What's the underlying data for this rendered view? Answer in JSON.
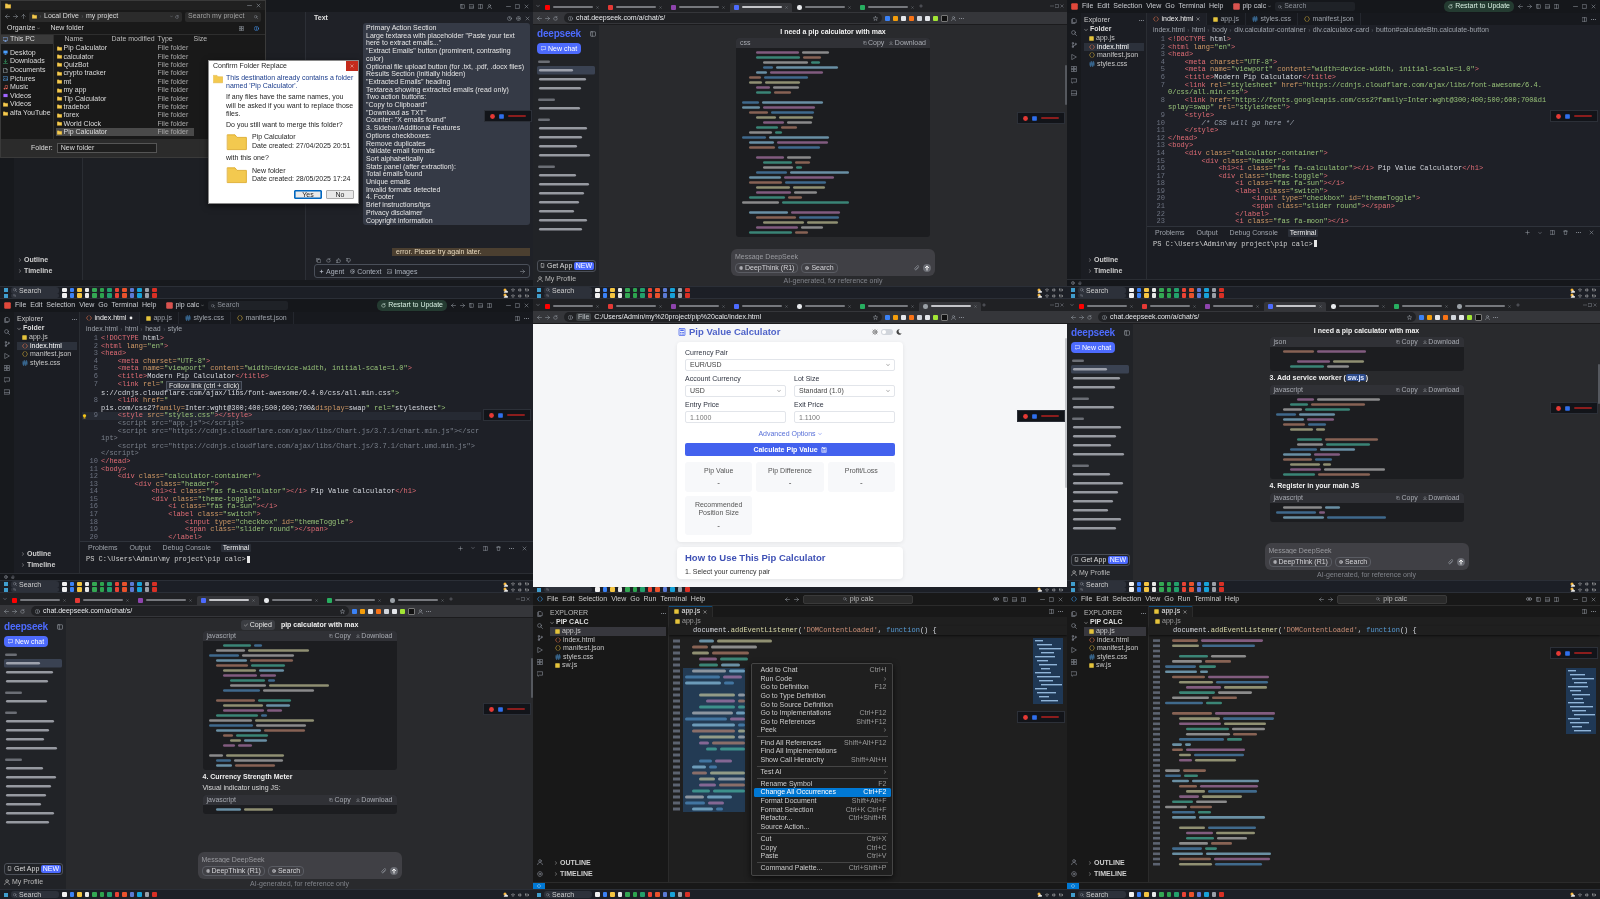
{
  "tiles": [
    {
      "kind": "explorer_chat",
      "top_taskbar": false,
      "taskbar": {
        "search": "Search"
      },
      "recorder": true,
      "explorer": {
        "path": [
          "Local Drive",
          "my project"
        ],
        "search_placeholder": "Search my project",
        "toolbar": [
          {
            "label": "Organize",
            "kind": "menu"
          },
          {
            "label": "New folder",
            "kind": "button"
          }
        ],
        "nav": [
          {
            "label": "This PC",
            "kind": "pc",
            "selected": true
          },
          {
            "label": "Desktop",
            "kind": "desktop",
            "selected": false
          },
          {
            "label": "Downloads",
            "kind": "downloads",
            "selected": false
          },
          {
            "label": "Documents",
            "kind": "documents",
            "selected": false
          },
          {
            "label": "Pictures",
            "kind": "pictures",
            "selected": false
          },
          {
            "label": "Music",
            "kind": "music",
            "selected": false
          },
          {
            "label": "Videos",
            "kind": "videos",
            "selected": false
          },
          {
            "label": "Videos",
            "kind": "folder",
            "selected": false
          },
          {
            "label": "alfa YouTube",
            "kind": "folder",
            "selected": false
          }
        ],
        "columns": [
          "Name",
          "Date modified",
          "Type",
          "Size"
        ],
        "rows": [
          {
            "name": "Pip Calculator",
            "type": "File folder",
            "selected": false
          },
          {
            "name": "calculator",
            "type": "File folder",
            "selected": false
          },
          {
            "name": "QuizBot",
            "type": "File folder",
            "selected": false
          },
          {
            "name": "crypto tracker",
            "type": "File folder",
            "selected": false
          },
          {
            "name": "mt",
            "type": "File folder",
            "selected": false
          },
          {
            "name": "my app",
            "type": "File folder",
            "selected": false
          },
          {
            "name": "Tip Calculator",
            "type": "File folder",
            "selected": false
          },
          {
            "name": "tradebot",
            "type": "File folder",
            "selected": false
          },
          {
            "name": "forex",
            "type": "File folder",
            "selected": false
          },
          {
            "name": "World Clock",
            "type": "File folder",
            "selected": false
          },
          {
            "name": "Pip Calculator",
            "type": "File folder",
            "selected": true
          }
        ],
        "folder_label": "Folder:",
        "folder_value": "New folder"
      },
      "dialog": {
        "title": "Confirm Folder Replace",
        "message": "This destination already contains a folder named 'Pip Calculator'.",
        "detail": "If any files have the same names, you will be asked if you want to replace those files.",
        "question": "Do you still want to merge this folder?",
        "existing": {
          "name": "Pip Calculator",
          "date": "Date created: 27/04/2025 20:51"
        },
        "with_label": "with this one?",
        "incoming": {
          "name": "New folder",
          "date": "Date created: 28/05/2025 17:24"
        },
        "buttons": [
          {
            "label": "Yes",
            "selected": true
          },
          {
            "label": "No",
            "selected": false
          }
        ]
      },
      "chat": {
        "title": "Text",
        "items": [
          "Primary Action Section",
          "Large textarea with placeholder \"Paste your text here to extract emails...\"",
          "\"Extract Emails\" button (prominent, contrasting color)",
          "Optional file upload button (for .txt, .pdf, .docx files)",
          "Results Section (initially hidden)",
          "\"Extracted Emails\" heading",
          "Textarea showing extracted emails (read only)",
          "Two action buttons:",
          "\"Copy to Clipboard\"",
          "\"Download as TXT\"",
          "Counter: \"X emails found\"",
          "3. Sidebar/Additional Features",
          "Options checkboxes:",
          "Remove duplicates",
          "Validate email formats",
          "Sort alphabetically",
          "Stats panel (after extraction):",
          "Total emails found",
          "Unique emails",
          "Invalid formats detected",
          "4. Footer",
          "Brief instructions/tips",
          "Privacy disclaimer",
          "Copyright information"
        ],
        "error": "error. Please try again later.",
        "chips": [
          {
            "label": "Agent",
            "kind": "agent"
          },
          {
            "label": "Context",
            "kind": "context"
          },
          {
            "label": "Images",
            "kind": "images"
          }
        ]
      },
      "panels": [
        "Outline",
        "Timeline"
      ]
    },
    {
      "kind": "deepseek",
      "top_taskbar": false,
      "taskbar": {
        "search": "Search"
      },
      "recorder": true,
      "browser": {
        "tabs": [
          {
            "selected": false
          },
          {
            "selected": false
          },
          {
            "selected": false
          },
          {
            "selected": true
          },
          {
            "selected": false
          },
          {
            "selected": false
          }
        ],
        "url": "chat.deepseek.com/a/chat/s/"
      },
      "sidebar": {
        "logo": "deepseek",
        "new_chat": "New chat",
        "sections": [
          {
            "items": [
              {
                "selected": true
              },
              {
                "selected": false
              },
              {
                "selected": false
              }
            ]
          },
          {
            "items": [
              {
                "selected": false
              }
            ]
          },
          {
            "items": [
              {
                "selected": false
              },
              {
                "selected": false
              },
              {
                "selected": false
              },
              {
                "selected": false
              }
            ]
          },
          {
            "items": [
              {
                "selected": false
              },
              {
                "selected": false
              },
              {
                "selected": false
              },
              {
                "selected": false
              },
              {
                "selected": false
              },
              {
                "selected": false
              },
              {
                "selected": false
              }
            ]
          }
        ],
        "get_app": "Get App",
        "badge": "NEW",
        "profile": "My Profile"
      },
      "chat": {
        "title": "I need a pip calculator with max",
        "blocks": [
          {
            "kind": "code",
            "lang": "css",
            "copy": "Copy",
            "download": "Download"
          }
        ],
        "placeholder": "Message DeepSeek",
        "chips": [
          {
            "label": "DeepThink (R1)",
            "kind": "deepthink"
          },
          {
            "label": "Search",
            "kind": "search"
          }
        ],
        "footer": "AI-generated, for reference only"
      }
    },
    {
      "kind": "editor",
      "top_taskbar": false,
      "taskbar": {
        "search": "Search"
      },
      "recorder": true,
      "menu": [
        "File",
        "Edit",
        "Selection",
        "View",
        "Go",
        "Terminal",
        "Help"
      ],
      "project": "pip calc",
      "search_placeholder": "Search",
      "update": "Restart to Update",
      "explorer": "Explorer",
      "folder": "Folder",
      "files": [
        {
          "name": "app.js",
          "kind": "js",
          "selected": false
        },
        {
          "name": "index.html",
          "kind": "html",
          "selected": true
        },
        {
          "name": "manifest.json",
          "kind": "json",
          "selected": false
        },
        {
          "name": "styles.css",
          "kind": "css",
          "selected": false
        }
      ],
      "tabs": [
        {
          "label": "index.html",
          "kind": "html",
          "selected": true,
          "modified": false
        },
        {
          "label": "app.js",
          "kind": "js",
          "selected": false,
          "modified": false
        },
        {
          "label": "styles.css",
          "kind": "css",
          "selected": false,
          "modified": false
        },
        {
          "label": "manifest.json",
          "kind": "json",
          "selected": false,
          "modified": false
        }
      ],
      "breadcrumb": [
        "index.html",
        "html",
        "body",
        "div.calculator-container",
        "div.calculator-card",
        "button#calculateBtn.calculate-button"
      ],
      "code": [
        {
          "n": "1",
          "kind": "line",
          "text": "<!DOCTYPE html>"
        },
        {
          "n": "2",
          "kind": "line",
          "text": "<html lang=\"en\">"
        },
        {
          "n": "3",
          "kind": "line",
          "text": "<head>"
        },
        {
          "n": "4",
          "kind": "line",
          "text": "    <meta charset=\"UTF-8\">"
        },
        {
          "n": "5",
          "kind": "line",
          "text": "    <meta name=\"viewport\" content=\"width=device-width, initial-scale=1.0\">"
        },
        {
          "n": "6",
          "kind": "line",
          "text": "    <title>Modern Pip Calculator</title>"
        },
        {
          "n": "7",
          "kind": "line",
          "text": "    <link rel=\"stylesheet\" href=\"https://cdnjs.cloudflare.com/ajax/libs/font-awesome/6.4.0/css/all.min.css\">"
        },
        {
          "n": "8",
          "kind": "line",
          "text": "    <link href=\"https://fonts.googleapis.com/css2?family=Inter:wght@300;400;500;600;700&display=swap\" rel=\"stylesheet\">"
        },
        {
          "n": "9",
          "kind": "line",
          "text": "    <style>"
        },
        {
          "n": "10",
          "kind": "line",
          "text": "        /* CSS will go here */"
        },
        {
          "n": "11",
          "kind": "line",
          "text": "    </style>"
        },
        {
          "n": "12",
          "kind": "line",
          "text": "</head>"
        },
        {
          "n": "13",
          "kind": "line",
          "text": "<body>"
        },
        {
          "n": "14",
          "kind": "line",
          "text": "    <div class=\"calculator-container\">"
        },
        {
          "n": "15",
          "kind": "line",
          "text": "        <div class=\"header\">"
        },
        {
          "n": "16",
          "kind": "line",
          "text": "            <h1><i class=\"fas fa-calculator\"></i> Pip Value Calculator</h1>"
        },
        {
          "n": "17",
          "kind": "line",
          "text": "            <div class=\"theme-toggle\">"
        },
        {
          "n": "18",
          "kind": "line",
          "text": "                <i class=\"fas fa-sun\"></i>"
        },
        {
          "n": "19",
          "kind": "line",
          "text": "                <label class=\"switch\">"
        },
        {
          "n": "20",
          "kind": "line",
          "text": "                    <input type=\"checkbox\" id=\"themeToggle\">"
        },
        {
          "n": "21",
          "kind": "line",
          "text": "                    <span class=\"slider round\"></span>"
        },
        {
          "n": "22",
          "kind": "line",
          "text": "                </label>"
        },
        {
          "n": "23",
          "kind": "line",
          "text": "                <i class=\"fas fa-moon\"></i>"
        }
      ],
      "panel_tabs": [
        {
          "label": "Problems",
          "selected": false
        },
        {
          "label": "Output",
          "selected": false
        },
        {
          "label": "Debug Console",
          "selected": false
        },
        {
          "label": "Terminal",
          "selected": true
        }
      ],
      "terminal": "PS C:\\Users\\Admin\\my project\\pip calc>",
      "sections": [
        "Outline",
        "Timeline"
      ]
    },
    {
      "kind": "editor",
      "top_taskbar": true,
      "taskbar": {
        "search": "Search"
      },
      "recorder": true,
      "menu": [
        "File",
        "Edit",
        "Selection",
        "View",
        "Go",
        "Terminal",
        "Help"
      ],
      "project": "pip calc",
      "search_placeholder": "Search",
      "update": "Restart to Update",
      "explorer": "Explorer",
      "folder": "Folder",
      "files": [
        {
          "name": "app.js",
          "kind": "js",
          "selected": false
        },
        {
          "name": "index.html",
          "kind": "html",
          "selected": true
        },
        {
          "name": "manifest.json",
          "kind": "json",
          "selected": false
        },
        {
          "name": "styles.css",
          "kind": "css",
          "selected": false
        }
      ],
      "tabs": [
        {
          "label": "index.html",
          "kind": "html",
          "selected": true,
          "modified": true
        },
        {
          "label": "app.js",
          "kind": "js",
          "selected": false,
          "modified": false
        },
        {
          "label": "styles.css",
          "kind": "css",
          "selected": false,
          "modified": false
        },
        {
          "label": "manifest.json",
          "kind": "json",
          "selected": false,
          "modified": false
        }
      ],
      "breadcrumb": [
        "index.html",
        "html",
        "head",
        "style"
      ],
      "code": [
        {
          "n": "1",
          "kind": "line",
          "text": "<!DOCTYPE html>"
        },
        {
          "n": "2",
          "kind": "line",
          "text": "<html lang=\"en\">"
        },
        {
          "n": "3",
          "kind": "line",
          "text": "<head>"
        },
        {
          "n": "4",
          "kind": "line",
          "text": "    <meta charset=\"UTF-8\">"
        },
        {
          "n": "5",
          "kind": "line",
          "text": "    <meta name=\"viewport\" content=\"width=device-width, initial-scale=1.0\">"
        },
        {
          "n": "6",
          "kind": "line",
          "text": "    <title>Modern Pip Calculator</title>"
        },
        {
          "n": "7",
          "kind": "line",
          "text": "    <link rel=\"",
          "tooltip": "Follow link (ctrl + click)",
          "after": "s://cdnjs.cloudflare.com/ajax/libs/font-awesome/6.4.0/css/all.min.css\">"
        },
        {
          "n": "8",
          "kind": "line",
          "text": "    <link href=\"",
          "after": "pis.com/css2?family=Inter:wght@300;400;500;600;700&display=swap\" rel=\"stylesheet\">"
        },
        {
          "n": "9",
          "kind": "current",
          "text": "    <style src=\"styles.css\"></style>"
        },
        {
          "kind": "ghost",
          "text": "    <script src=\"app.js\"></script>"
        },
        {
          "kind": "ghost",
          "text": "    <script src=\"https://cdnjs.cloudflare.com/ajax/libs/Chart.js/3.7.1/chart.min.js\"></script>"
        },
        {
          "kind": "ghost",
          "text": "    <script src=\"https://cdnjs.cloudflare.com/ajax/libs/Chart.js/3.7.1/chart.umd.min.js\"></script>"
        },
        {
          "n": "10",
          "kind": "line",
          "text": "</head>"
        },
        {
          "n": "11",
          "kind": "line",
          "text": "<body>"
        },
        {
          "n": "12",
          "kind": "line",
          "text": "    <div class=\"calculator-container\">"
        },
        {
          "n": "13",
          "kind": "line",
          "text": "        <div class=\"header\">"
        },
        {
          "n": "14",
          "kind": "line",
          "text": "            <h1><i class=\"fas fa-calculator\"></i> Pip Value Calculator</h1>"
        },
        {
          "n": "15",
          "kind": "line",
          "text": "            <div class=\"theme-toggle\">"
        },
        {
          "n": "16",
          "kind": "line",
          "text": "                <i class=\"fas fa-sun\"></i>"
        },
        {
          "n": "17",
          "kind": "line",
          "text": "                <label class=\"switch\">"
        },
        {
          "n": "18",
          "kind": "line",
          "text": "                    <input type=\"checkbox\" id=\"themeToggle\">"
        },
        {
          "n": "19",
          "kind": "line",
          "text": "                    <span class=\"slider round\"></span>"
        },
        {
          "n": "20",
          "kind": "line",
          "text": "                </label>"
        }
      ],
      "panel_tabs": [
        {
          "label": "Problems",
          "selected": false
        },
        {
          "label": "Output",
          "selected": false
        },
        {
          "label": "Debug Console",
          "selected": false
        },
        {
          "label": "Terminal",
          "selected": true
        }
      ],
      "terminal": "PS C:\\Users\\Admin\\my project\\pip calc>",
      "sections": [
        "Outline",
        "Timeline"
      ]
    },
    {
      "kind": "calculator",
      "top_taskbar": true,
      "recorder": true,
      "browser": {
        "tabs": [
          {
            "selected": false
          },
          {
            "selected": false
          },
          {
            "selected": false
          },
          {
            "selected": false
          },
          {
            "selected": false
          },
          {
            "selected": false
          },
          {
            "selected": true
          }
        ],
        "scheme": "File",
        "url": "C:/Users/Admin/my%20project/pip%20calc/index.html"
      },
      "page": {
        "title": "Pip Value Calculator",
        "dark_mode": false,
        "field_rows": [
          [
            {
              "label": "Currency Pair",
              "kind": "select",
              "value": "EUR/USD"
            }
          ],
          [
            {
              "label": "Account Currency",
              "kind": "select",
              "value": "USD"
            },
            {
              "label": "Lot Size",
              "kind": "select",
              "value": "Standard (1.0)"
            }
          ],
          [
            {
              "label": "Entry Price",
              "kind": "input",
              "placeholder": "1.1000"
            },
            {
              "label": "Exit Price",
              "kind": "input",
              "placeholder": "1.1100"
            }
          ]
        ],
        "advanced": "Advanced Options",
        "button": "Calculate Pip Value",
        "results": [
          {
            "label": "Pip Value",
            "value": "-"
          },
          {
            "label": "Pip Difference",
            "value": "-"
          },
          {
            "label": "Profit/Loss",
            "value": "-"
          },
          {
            "label": "Recommended Position Size",
            "value": "-"
          }
        ],
        "howto_title": "How to Use This Pip Calculator",
        "howto_steps": [
          "1. Select your currency pair"
        ]
      }
    },
    {
      "kind": "deepseek",
      "top_taskbar": true,
      "taskbar": {
        "search": "Search"
      },
      "recorder": true,
      "browser": {
        "tabs": [
          {
            "selected": false
          },
          {
            "selected": false
          },
          {
            "selected": false
          },
          {
            "selected": true
          },
          {
            "selected": false
          },
          {
            "selected": false
          },
          {
            "selected": false
          }
        ],
        "url": "chat.deepseek.com/a/chat/s/"
      },
      "sidebar": {
        "logo": "deepseek",
        "new_chat": "New chat",
        "sections": [
          {
            "items": [
              {
                "selected": true
              },
              {
                "selected": false
              },
              {
                "selected": false
              }
            ]
          },
          {
            "items": [
              {
                "selected": false
              }
            ]
          },
          {
            "items": [
              {
                "selected": false
              },
              {
                "selected": false
              },
              {
                "selected": false
              },
              {
                "selected": false
              }
            ]
          },
          {
            "items": [
              {
                "selected": false
              },
              {
                "selected": false
              },
              {
                "selected": false
              },
              {
                "selected": false
              },
              {
                "selected": false
              },
              {
                "selected": false
              },
              {
                "selected": false
              }
            ]
          }
        ],
        "get_app": "Get App",
        "badge": "NEW",
        "profile": "My Profile"
      },
      "chat": {
        "title": "I need a pip calculator with max",
        "blocks": [
          {
            "kind": "code",
            "lang": "json",
            "copy": "Copy",
            "download": "Download"
          },
          {
            "kind": "heading",
            "text": "3. Add service worker (",
            "code": "sw.js",
            "tail": ")"
          },
          {
            "kind": "code",
            "lang": "javascript",
            "copy": "Copy",
            "download": "Download"
          },
          {
            "kind": "heading",
            "text": "4. Register in your main JS"
          },
          {
            "kind": "code",
            "lang": "javascript",
            "copy": "Copy",
            "download": "Download"
          }
        ],
        "placeholder": "Message DeepSeek",
        "chips": [
          {
            "label": "DeepThink (R1)",
            "kind": "deepthink"
          },
          {
            "label": "Search",
            "kind": "search"
          }
        ],
        "footer": "AI-generated, for reference only"
      }
    },
    {
      "kind": "deepseek",
      "top_taskbar": true,
      "taskbar": {
        "search": "Search"
      },
      "recorder": true,
      "browser": {
        "tabs": [
          {
            "selected": false
          },
          {
            "selected": false
          },
          {
            "selected": false
          },
          {
            "selected": true
          },
          {
            "selected": false
          },
          {
            "selected": false
          },
          {
            "selected": false
          }
        ],
        "url": "chat.deepseek.com/a/chat/s/"
      },
      "sidebar": {
        "logo": "deepseek",
        "new_chat": "New chat",
        "sections": [
          {
            "items": [
              {
                "selected": true
              },
              {
                "selected": false
              },
              {
                "selected": false
              }
            ]
          },
          {
            "items": [
              {
                "selected": false
              }
            ]
          },
          {
            "items": [
              {
                "selected": false
              },
              {
                "selected": false
              },
              {
                "selected": false
              },
              {
                "selected": false
              }
            ]
          },
          {
            "items": [
              {
                "selected": false
              },
              {
                "selected": false
              },
              {
                "selected": false
              },
              {
                "selected": false
              },
              {
                "selected": false
              },
              {
                "selected": false
              },
              {
                "selected": false
              }
            ]
          }
        ],
        "get_app": "Get App",
        "badge": "NEW",
        "profile": "My Profile"
      },
      "chat": {
        "toast": "Copied",
        "title": "pip calculator with max",
        "blocks": [
          {
            "kind": "code",
            "lang": "javascript",
            "copy": "Copy",
            "download": "Download"
          },
          {
            "kind": "heading",
            "text": "4. Currency Strength Meter"
          },
          {
            "kind": "text",
            "text": "Visual indicator using JS:"
          },
          {
            "kind": "code",
            "lang": "javascript",
            "copy": "Copy",
            "download": "Download"
          }
        ],
        "placeholder": "Message DeepSeek",
        "chips": [
          {
            "label": "DeepThink (R1)",
            "kind": "deepthink"
          },
          {
            "label": "Search",
            "kind": "search"
          }
        ],
        "footer": "AI-generated, for reference only"
      }
    },
    {
      "kind": "vscode",
      "top_taskbar": true,
      "taskbar": {
        "search": "Search"
      },
      "recorder": true,
      "menu": [
        "File",
        "Edit",
        "Selection",
        "View",
        "Go",
        "Run",
        "Terminal",
        "Help"
      ],
      "command_center": "pip calc",
      "explorer": "EXPLORER",
      "folder": "PIP CALC",
      "files": [
        {
          "name": "app.js",
          "kind": "js",
          "selected": true
        },
        {
          "name": "index.html",
          "kind": "html",
          "selected": false
        },
        {
          "name": "manifest.json",
          "kind": "json",
          "selected": false
        },
        {
          "name": "styles.css",
          "kind": "css",
          "selected": false
        },
        {
          "name": "sw.js",
          "kind": "js",
          "selected": false
        }
      ],
      "tabs": [
        {
          "label": "app.js",
          "kind": "js",
          "selected": true,
          "modified": false
        }
      ],
      "breadcrumb": [
        "app.js"
      ],
      "sticky": "document.addEventListener('DOMContentLoaded', function() {",
      "context_menu": [
        {
          "kind": "item",
          "label": "Add to Chat",
          "shortcut": "Ctrl+I",
          "submenu": false,
          "selected": false
        },
        {
          "kind": "item",
          "label": "Run Code",
          "submenu": true,
          "selected": false
        },
        {
          "kind": "item",
          "label": "Go to Definition",
          "shortcut": "F12",
          "submenu": false,
          "selected": false
        },
        {
          "kind": "item",
          "label": "Go to Type Definition",
          "submenu": false,
          "selected": false
        },
        {
          "kind": "item",
          "label": "Go to Source Definition",
          "submenu": false,
          "selected": false
        },
        {
          "kind": "item",
          "label": "Go to Implementations",
          "shortcut": "Ctrl+F12",
          "submenu": false,
          "selected": false
        },
        {
          "kind": "item",
          "label": "Go to References",
          "shortcut": "Shift+F12",
          "submenu": false,
          "selected": false
        },
        {
          "kind": "item",
          "label": "Peek",
          "submenu": true,
          "selected": false
        },
        {
          "kind": "separator"
        },
        {
          "kind": "item",
          "label": "Find All References",
          "shortcut": "Shift+Alt+F12",
          "submenu": false,
          "selected": false
        },
        {
          "kind": "item",
          "label": "Find All Implementations",
          "submenu": false,
          "selected": false
        },
        {
          "kind": "item",
          "label": "Show Call Hierarchy",
          "shortcut": "Shift+Alt+H",
          "submenu": false,
          "selected": false
        },
        {
          "kind": "separator"
        },
        {
          "kind": "item",
          "label": "Test AI",
          "submenu": true,
          "selected": false
        },
        {
          "kind": "separator"
        },
        {
          "kind": "item",
          "label": "Rename Symbol",
          "shortcut": "F2",
          "submenu": false,
          "selected": false
        },
        {
          "kind": "item",
          "label": "Change All Occurrences",
          "shortcut": "Ctrl+F2",
          "submenu": false,
          "selected": true
        },
        {
          "kind": "item",
          "label": "Format Document",
          "shortcut": "Shift+Alt+F",
          "submenu": false,
          "selected": false
        },
        {
          "kind": "item",
          "label": "Format Selection",
          "shortcut": "Ctrl+K Ctrl+F",
          "submenu": false,
          "selected": false
        },
        {
          "kind": "item",
          "label": "Refactor...",
          "shortcut": "Ctrl+Shift+R",
          "submenu": false,
          "selected": false
        },
        {
          "kind": "item",
          "label": "Source Action...",
          "submenu": false,
          "selected": false
        },
        {
          "kind": "separator"
        },
        {
          "kind": "item",
          "label": "Cut",
          "shortcut": "Ctrl+X",
          "submenu": false,
          "selected": false
        },
        {
          "kind": "item",
          "label": "Copy",
          "shortcut": "Ctrl+C",
          "submenu": false,
          "selected": false
        },
        {
          "kind": "item",
          "label": "Paste",
          "shortcut": "Ctrl+V",
          "submenu": false,
          "selected": false
        },
        {
          "kind": "separator"
        },
        {
          "kind": "item",
          "label": "Command Palette...",
          "shortcut": "Ctrl+Shift+P",
          "submenu": false,
          "selected": false
        }
      ],
      "sections": [
        "OUTLINE",
        "TIMELINE"
      ]
    },
    {
      "kind": "vscode",
      "top_taskbar": true,
      "taskbar": {
        "search": "Search"
      },
      "recorder": true,
      "menu": [
        "File",
        "Edit",
        "Selection",
        "View",
        "Go",
        "Run",
        "Terminal",
        "Help"
      ],
      "command_center": "pip calc",
      "explorer": "EXPLORER",
      "folder": "PIP CALC",
      "files": [
        {
          "name": "app.js",
          "kind": "js",
          "selected": true
        },
        {
          "name": "index.html",
          "kind": "html",
          "selected": false
        },
        {
          "name": "manifest.json",
          "kind": "json",
          "selected": false
        },
        {
          "name": "styles.css",
          "kind": "css",
          "selected": false
        },
        {
          "name": "sw.js",
          "kind": "js",
          "selected": false
        }
      ],
      "tabs": [
        {
          "label": "app.js",
          "kind": "js",
          "selected": true,
          "modified": false
        }
      ],
      "breadcrumb": [
        "app.js"
      ],
      "sticky": "document.addEventListener('DOMContentLoaded', function() {",
      "sections": [
        "OUTLINE",
        "TIMELINE"
      ]
    }
  ]
}
